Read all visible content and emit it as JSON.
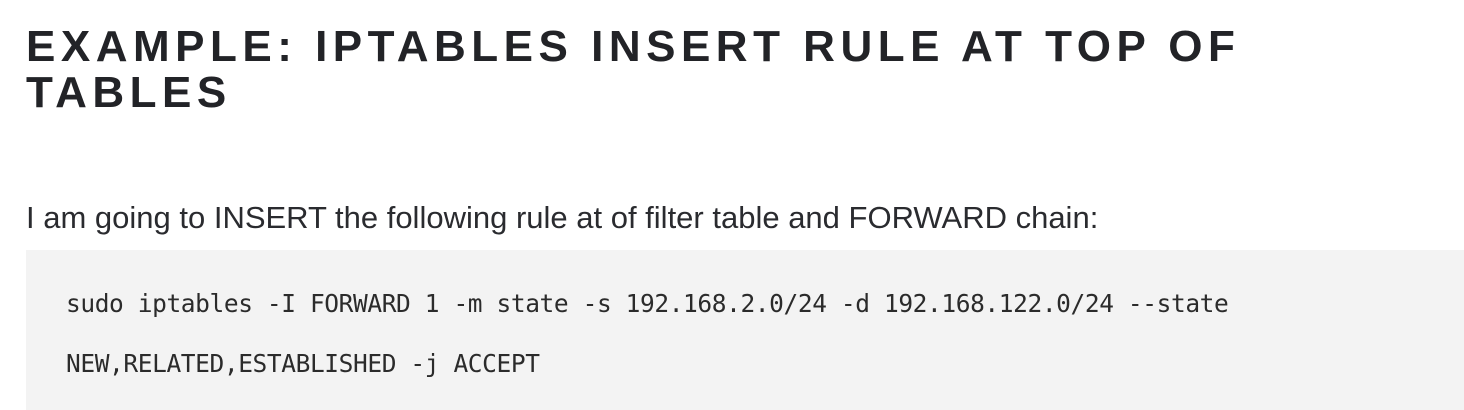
{
  "article": {
    "heading": "EXAMPLE: IPTABLES INSERT RULE AT TOP OF TABLES",
    "intro": "I am going to INSERT the following rule at of filter table and FORWARD chain:",
    "code": {
      "lines": [
        "sudo iptables -I FORWARD 1 -m state -s 192.168.2.0/24 -d 192.168.122.0/24 --state",
        "NEW,RELATED,ESTABLISHED -j ACCEPT"
      ]
    }
  }
}
